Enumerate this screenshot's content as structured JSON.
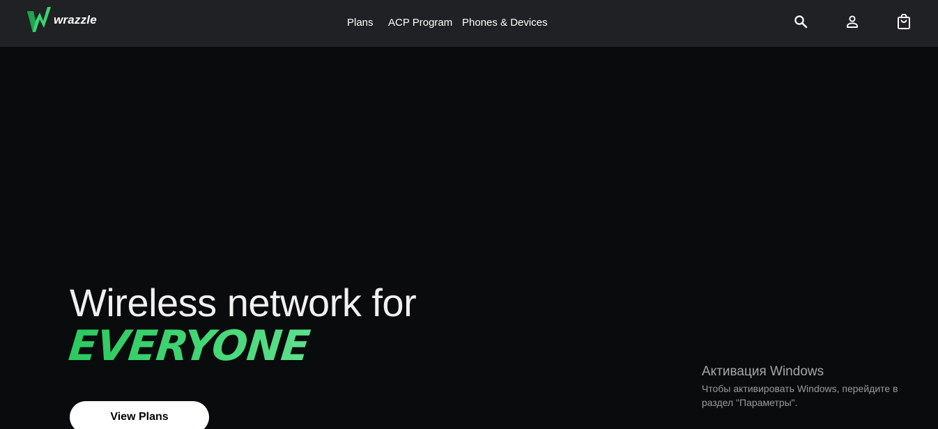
{
  "brand": {
    "name": "wrazzle",
    "logo_icon": "lightning-w-icon",
    "accent": "#3bd36f"
  },
  "nav": {
    "items": [
      {
        "label": "Plans"
      },
      {
        "label": "ACP Program"
      },
      {
        "label": "Phones & Devices"
      }
    ]
  },
  "header_icons": [
    "search-icon",
    "user-icon",
    "shopping-bag-icon"
  ],
  "hero": {
    "title": "Wireless network for",
    "accent": "EVERYONE",
    "cta_label": "View Plans"
  },
  "os_overlay": {
    "title": "Активация Windows",
    "line1": "Чтобы активировать Windows, перейдите в",
    "line2": "раздел \"Параметры\"."
  }
}
